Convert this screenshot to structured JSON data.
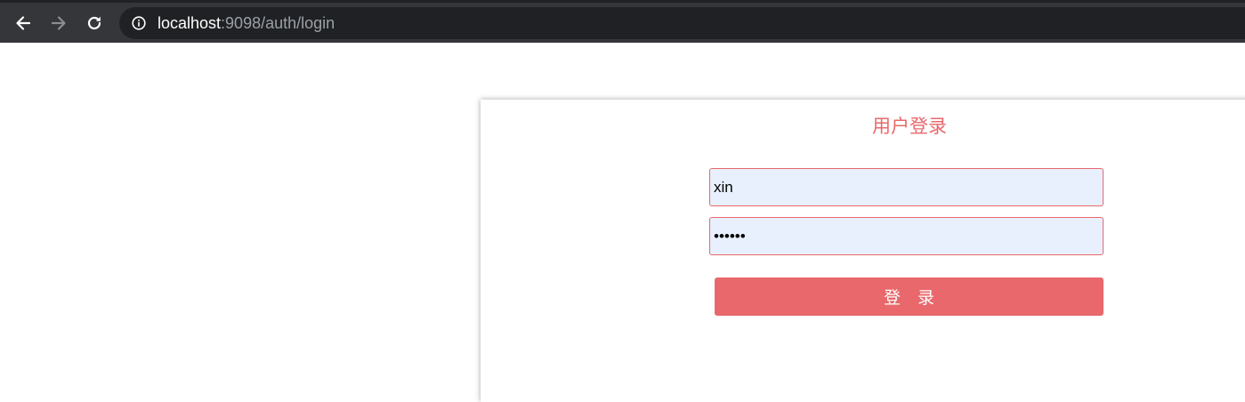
{
  "browser": {
    "url_host": "localhost",
    "url_rest": ":9098/auth/login"
  },
  "login": {
    "title": "用户登录",
    "username_value": "xin",
    "password_value": "••••••",
    "submit_label": "登　录"
  },
  "colors": {
    "accent": "#e8686b",
    "input_background": "#e8f0fe",
    "toolbar": "#35363a",
    "omnibox": "#202124"
  },
  "icons": [
    "back-arrow-icon",
    "forward-arrow-icon",
    "reload-icon",
    "info-icon"
  ]
}
